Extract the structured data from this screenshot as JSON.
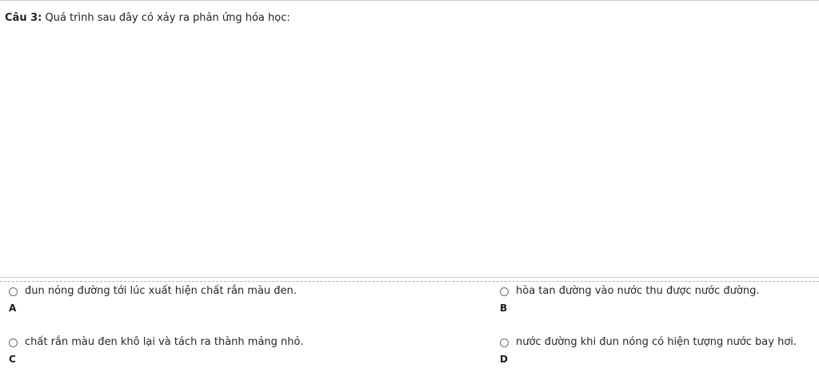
{
  "question": {
    "number_label": "Câu 3:",
    "text": "Quá trình sau đây có xảy ra phản ứng hóa học:"
  },
  "options": [
    {
      "letter": "A",
      "text": "đun nóng đường tới lúc xuất hiện chất rắn màu đen."
    },
    {
      "letter": "B",
      "text": "hòa tan đường vào nước thu được nước đường."
    },
    {
      "letter": "C",
      "text": "chất rắn màu đen khô lại và tách ra thành mảng nhỏ."
    },
    {
      "letter": "D",
      "text": "nước đường khi đun nóng có hiện tượng nước bay hơi."
    }
  ]
}
